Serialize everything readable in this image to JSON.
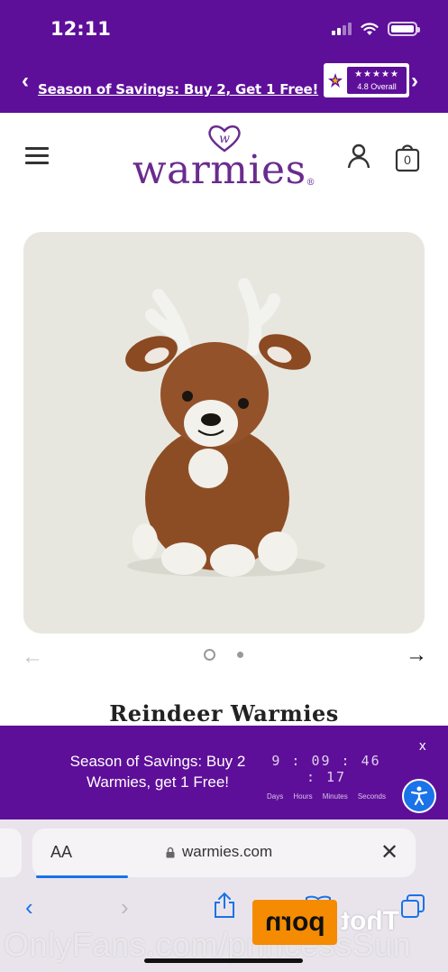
{
  "status_bar": {
    "time": "12:11"
  },
  "promo": {
    "text": "Season of Savings: Buy 2, Get 1 Free!",
    "rating_stars": "★★★★★",
    "rating_text": "4.8 Overall"
  },
  "header": {
    "logo_text": "warmies",
    "logo_mark": "®",
    "cart_count": "0"
  },
  "product": {
    "title": "Reindeer Warmies",
    "gallery": {
      "current_index": 1,
      "total": 2
    }
  },
  "countdown": {
    "message": "Season of Savings: Buy 2 Warmies, get 1 Free!",
    "timer": "9 : 09 : 46 : 17",
    "units": [
      "Days",
      "Hours",
      "Minutes",
      "Seconds"
    ],
    "close_label": "x"
  },
  "browser": {
    "aa_label": "AA",
    "url": "warmies.com"
  },
  "watermark": {
    "text": "OnlyFans.com/princessSun",
    "logo_text": "porn",
    "logo_tail": "Thot"
  },
  "colors": {
    "brand_purple": "#5e0f99",
    "logo_purple": "#6a2b8e",
    "safari_blue": "#1a73e8"
  }
}
